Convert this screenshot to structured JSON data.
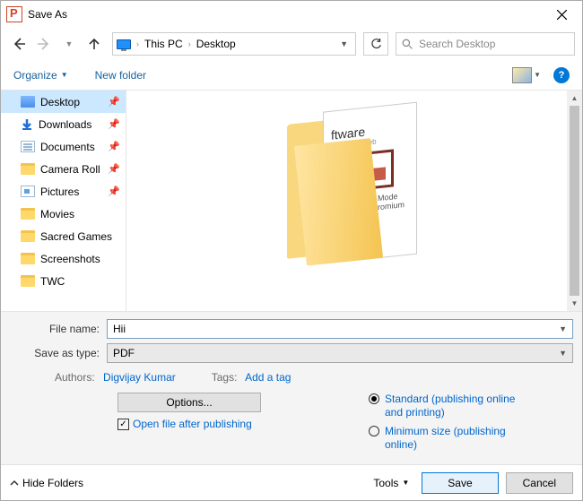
{
  "title": "Save As",
  "breadcrumb": {
    "root": "This PC",
    "leaf": "Desktop"
  },
  "search": {
    "placeholder": "Search Desktop"
  },
  "toolbar": {
    "organize": "Organize",
    "newfolder": "New folder"
  },
  "sidebar": {
    "items": [
      {
        "label": "Desktop",
        "pinned": true,
        "selected": true,
        "icon": "desktop"
      },
      {
        "label": "Downloads",
        "pinned": true,
        "icon": "download"
      },
      {
        "label": "Documents",
        "pinned": true,
        "icon": "doc"
      },
      {
        "label": "Camera Roll",
        "pinned": true,
        "icon": "folder"
      },
      {
        "label": "Pictures",
        "pinned": true,
        "icon": "pic"
      },
      {
        "label": "Movies",
        "icon": "folder"
      },
      {
        "label": "Sacred Games",
        "icon": "folder"
      },
      {
        "label": "Screenshots",
        "icon": "folder"
      },
      {
        "label": "TWC",
        "icon": "folder"
      }
    ]
  },
  "preview": {
    "line1": "ftware",
    "line2": "le on this Web",
    "line3": "re-In-Picture Mode",
    "line4": "soft Edge Chromium"
  },
  "form": {
    "filename_label": "File name:",
    "filename_value": "Hii",
    "type_label": "Save as type:",
    "type_value": "PDF",
    "authors_label": "Authors:",
    "authors_value": "Digvijay Kumar",
    "tags_label": "Tags:",
    "tags_value": "Add a tag",
    "options_btn": "Options...",
    "open_after": "Open file after publishing",
    "radio_standard": "Standard (publishing online and printing)",
    "radio_min": "Minimum size (publishing online)"
  },
  "footer": {
    "hide": "Hide Folders",
    "tools": "Tools",
    "save": "Save",
    "cancel": "Cancel"
  }
}
